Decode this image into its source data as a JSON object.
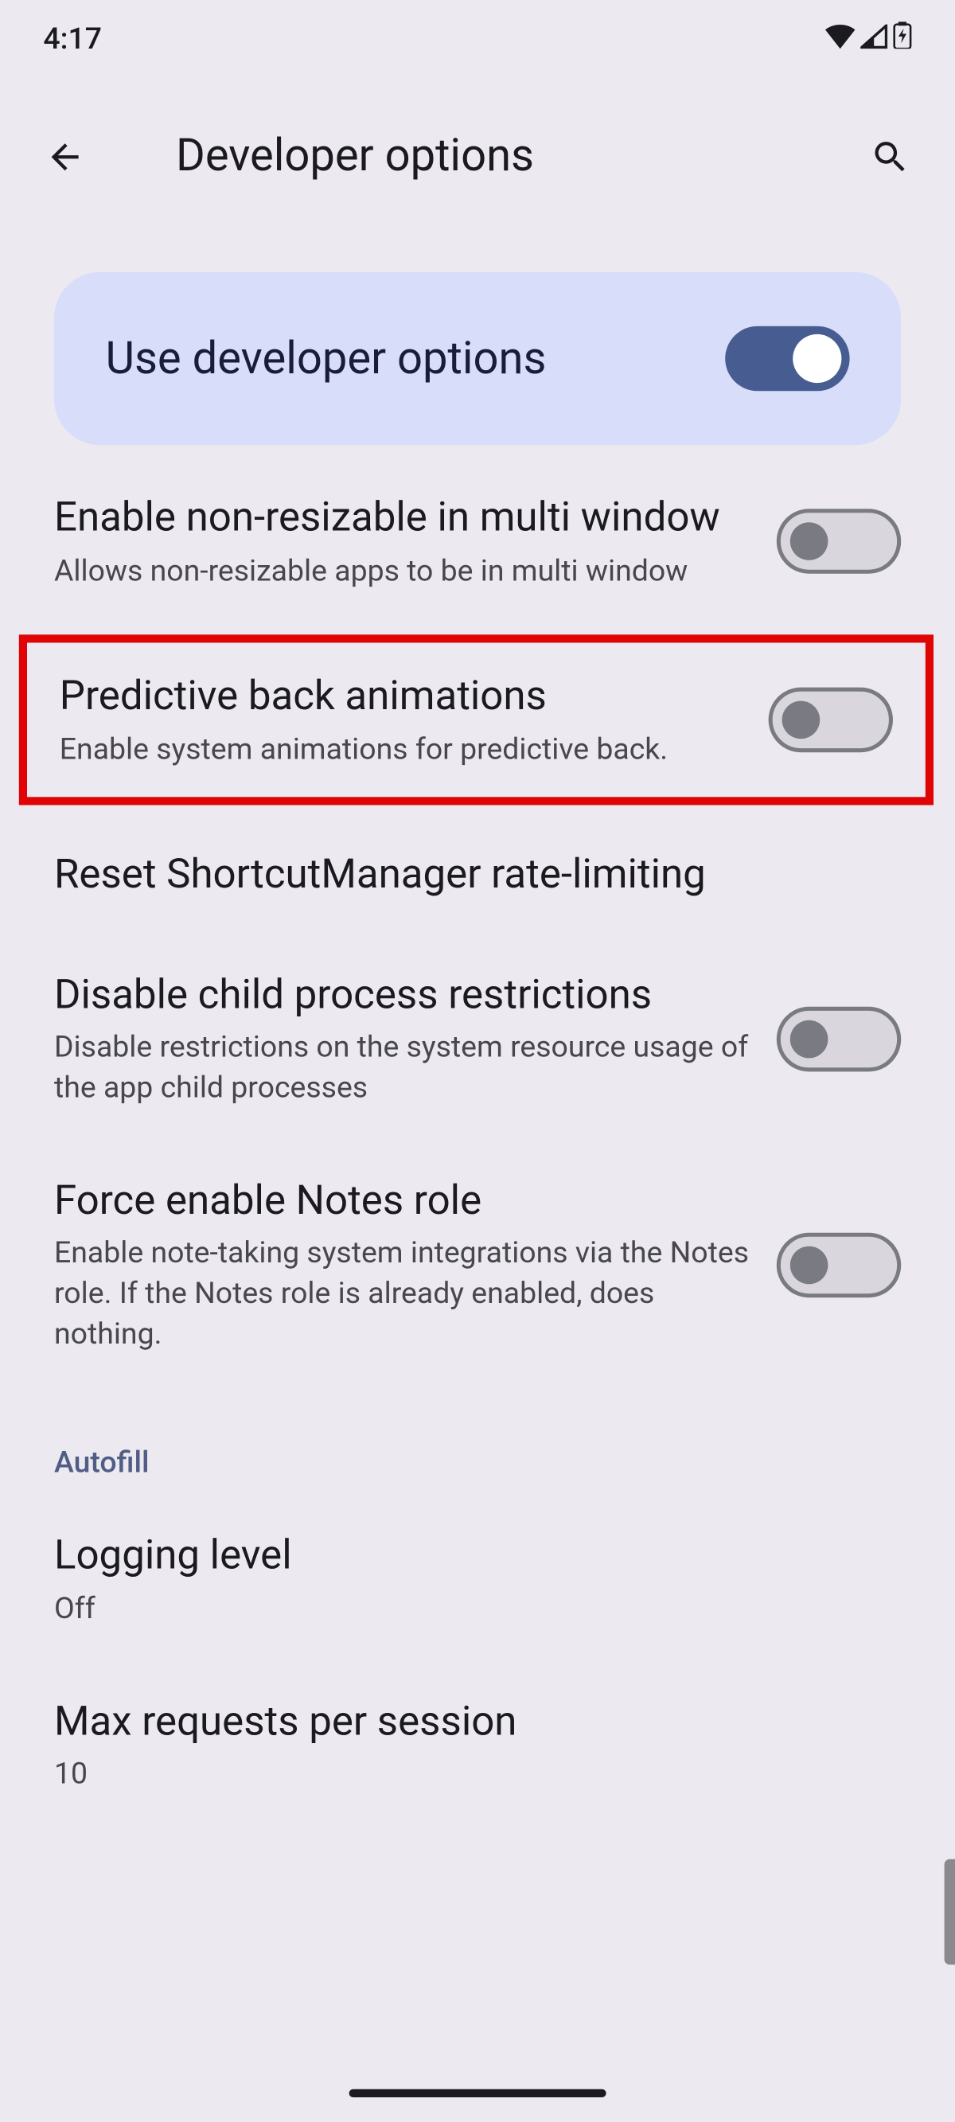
{
  "status": {
    "time": "4:17"
  },
  "header": {
    "title": "Developer options"
  },
  "hero": {
    "title": "Use developer options",
    "enabled": true
  },
  "settings": [
    {
      "id": "multiwindow",
      "title": "Enable non-resizable in multi window",
      "desc": "Allows non-resizable apps to be in multi window",
      "enabled": false
    },
    {
      "id": "predictive",
      "title": "Predictive back animations",
      "desc": "Enable system animations for predictive back.",
      "enabled": false,
      "highlighted": true
    },
    {
      "id": "shortcut",
      "title": "Reset ShortcutManager rate-limiting",
      "desc": ""
    },
    {
      "id": "childproc",
      "title": "Disable child process restrictions",
      "desc": "Disable restrictions on the system resource usage of the app child processes",
      "enabled": false
    },
    {
      "id": "notesrole",
      "title": "Force enable Notes role",
      "desc": "Enable note-taking system integrations via the Notes role. If the Notes role is already enabled, does nothing.",
      "enabled": false
    }
  ],
  "section": {
    "label": "Autofill"
  },
  "autofill": [
    {
      "id": "logging",
      "title": "Logging level",
      "desc": "Off"
    },
    {
      "id": "maxreq",
      "title": "Max requests per session",
      "desc": "10"
    }
  ]
}
